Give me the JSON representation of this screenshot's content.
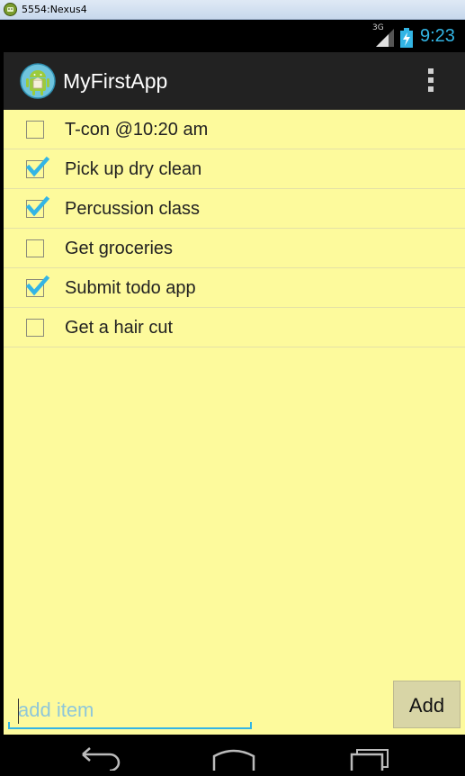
{
  "window": {
    "title": "5554:Nexus4"
  },
  "status_bar": {
    "network": "3G",
    "clock": "9:23"
  },
  "action_bar": {
    "app_title": "MyFirstApp"
  },
  "todo_items": [
    {
      "label": "T-con @10:20 am",
      "checked": false
    },
    {
      "label": "Pick up dry clean",
      "checked": true
    },
    {
      "label": "Percussion class",
      "checked": true
    },
    {
      "label": "Get groceries",
      "checked": false
    },
    {
      "label": "Submit todo app",
      "checked": true
    },
    {
      "label": "Get a hair cut",
      "checked": false
    }
  ],
  "add_item": {
    "placeholder": "add item",
    "value": "",
    "button_label": "Add"
  },
  "colors": {
    "content_bg": "#fdfa9c",
    "accent": "#33b5e5",
    "action_bar": "#222222"
  }
}
